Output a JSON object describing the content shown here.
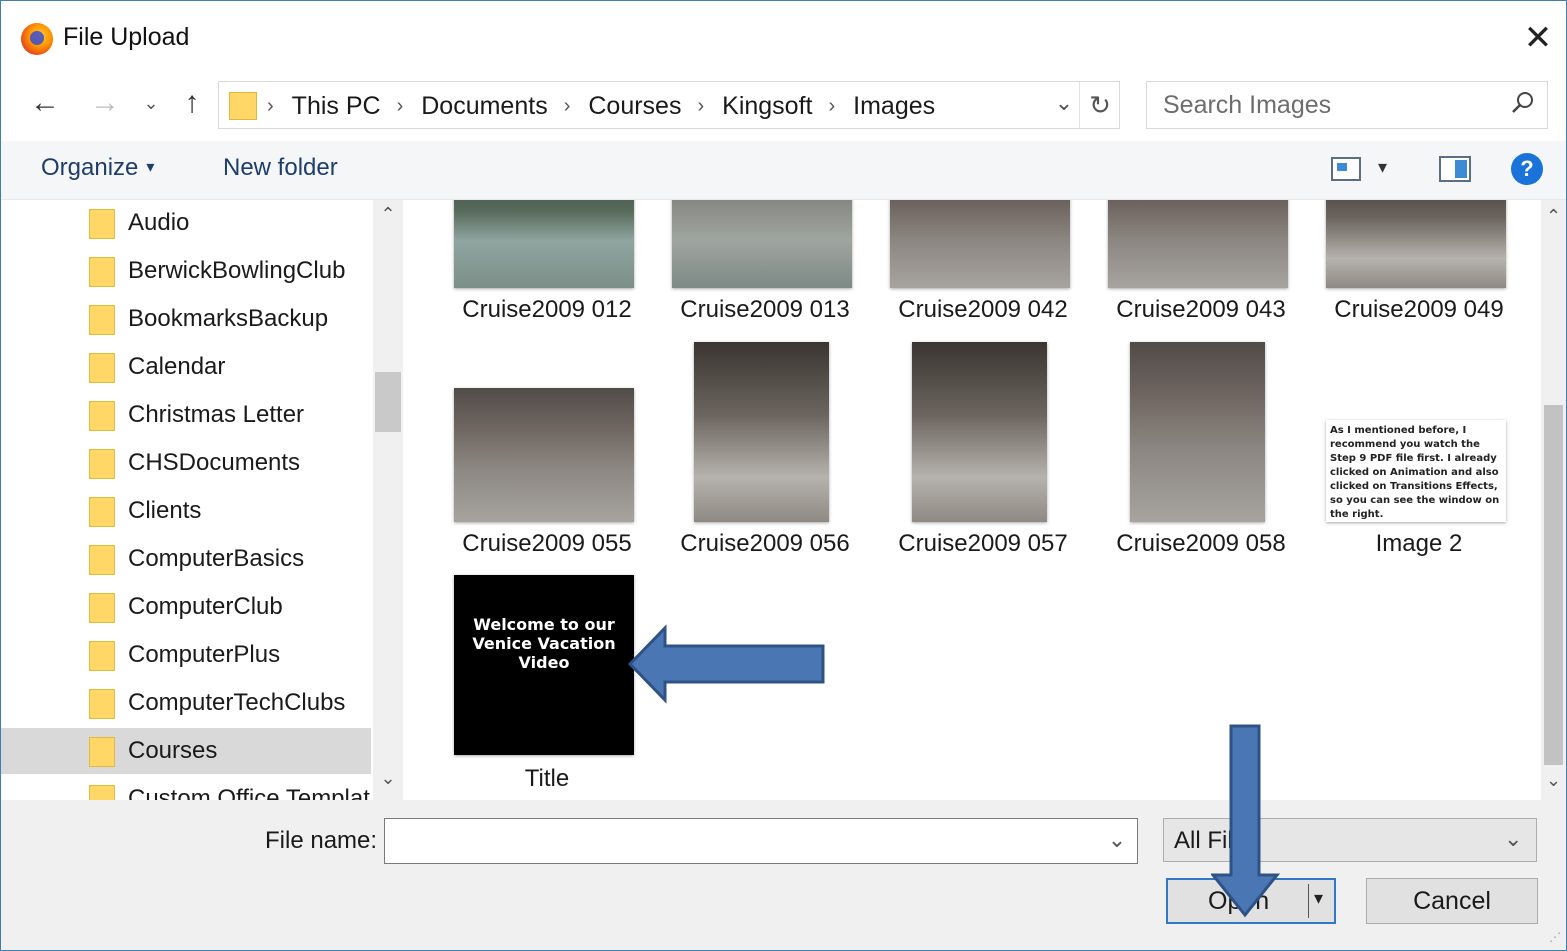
{
  "window": {
    "title": "File Upload",
    "close_glyph": "✕"
  },
  "nav": {
    "back_glyph": "←",
    "forward_glyph": "→",
    "recent_glyph": "⌄",
    "up_glyph": "↑",
    "breadcrumbs": [
      "This PC",
      "Documents",
      "Courses",
      "Kingsoft",
      "Images"
    ],
    "crumb_sep": "›",
    "dropdown_glyph": "⌄",
    "refresh_glyph": "↻"
  },
  "search": {
    "placeholder": "Search Images",
    "icon": "search-icon"
  },
  "toolbar": {
    "organize": "Organize",
    "new_folder": "New folder",
    "caret": "▾",
    "help": "?"
  },
  "folders": [
    "Audio",
    "BerwickBowlingClub",
    "BookmarksBackup",
    "Calendar",
    "Christmas Letter",
    "CHSDocuments",
    "Clients",
    "ComputerBasics",
    "ComputerClub",
    "ComputerPlus",
    "ComputerTechClubs",
    "Courses",
    "Custom Office Templat"
  ],
  "selected_folder": "Courses",
  "files": [
    {
      "name": "Cruise2009 012"
    },
    {
      "name": "Cruise2009 013"
    },
    {
      "name": "Cruise2009 042"
    },
    {
      "name": "Cruise2009 043"
    },
    {
      "name": "Cruise2009 049"
    },
    {
      "name": "Cruise2009 055"
    },
    {
      "name": "Cruise2009 056"
    },
    {
      "name": "Cruise2009 057"
    },
    {
      "name": "Cruise2009 058"
    },
    {
      "name": "Image 2",
      "thumb_text": "As I mentioned before, I recommend you watch the Step 9 PDF file first.  I already clicked on Animation and also clicked on Transitions Effects, so you can see the window on the right."
    },
    {
      "name": "Title",
      "thumb_text": "Welcome to our Venice Vacation Video"
    }
  ],
  "scroll": {
    "up_glyph": "⌃",
    "down_glyph": "⌄"
  },
  "bottom": {
    "file_name_label": "File name:",
    "file_name_value": "",
    "filter_value": "All Fil",
    "open_label": "Open",
    "open_drop": "▾",
    "cancel_label": "Cancel",
    "dropdown_glyph": "⌄",
    "grip": "⋰"
  },
  "colors": {
    "accent": "#2f79c8",
    "arrow_fill": "#4a76b4",
    "arrow_stroke": "#2f5286",
    "folder": "#ffd766"
  }
}
